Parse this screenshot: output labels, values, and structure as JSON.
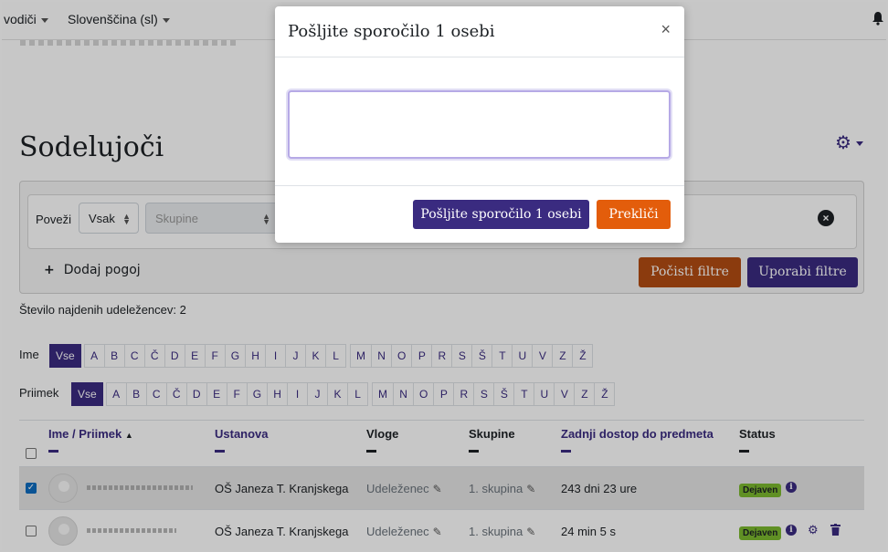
{
  "nav": {
    "item1": "vodiči",
    "item2": "Slovenščina (sl)"
  },
  "page": {
    "title": "Sodelujoči"
  },
  "filters": {
    "label": "Poveži",
    "match": "Vsak",
    "field_placeholder": "Skupine",
    "add_condition": "Dodaj pogoj",
    "clear": "Počisti filtre",
    "apply": "Uporabi filtre"
  },
  "count_text": "Število najdenih udeležencev: 2",
  "initials": {
    "first_label": "Ime",
    "last_label": "Priimek",
    "all": "Vse",
    "letters": [
      "A",
      "B",
      "C",
      "Č",
      "D",
      "E",
      "F",
      "G",
      "H",
      "I",
      "J",
      "K",
      "L",
      "M",
      "N",
      "O",
      "P",
      "R",
      "S",
      "Š",
      "T",
      "U",
      "V",
      "Z",
      "Ž"
    ]
  },
  "table": {
    "headers": [
      "Ime / Priimek",
      "Ustanova",
      "Vloge",
      "Skupine",
      "Zadnji dostop do predmeta",
      "Status"
    ],
    "rows": [
      {
        "institution": "OŠ Janeza T. Kranjskega",
        "role": "Udeleženec",
        "group": "1. skupina",
        "last_access": "243 dni 23 ure",
        "status": "Dejaven",
        "checked": true
      },
      {
        "institution": "OŠ Janeza T. Kranjskega",
        "role": "Udeleženec",
        "group": "1. skupina",
        "last_access": "24 min 5 s",
        "status": "Dejaven",
        "checked": false
      }
    ]
  },
  "modal": {
    "title": "Pošljite sporočilo 1 osebi",
    "close": "×",
    "message_value": "",
    "send": "Pošljite sporočilo 1 osebi",
    "cancel": "Prekliči"
  }
}
